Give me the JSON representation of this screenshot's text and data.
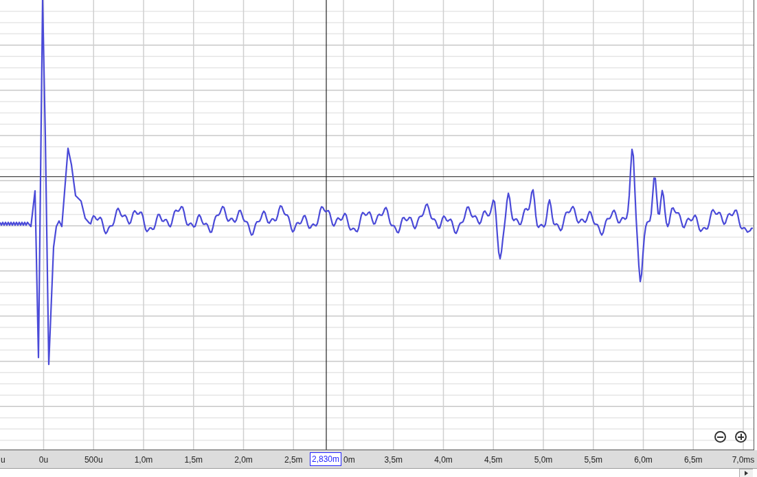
{
  "x_axis": {
    "labels": [
      "u",
      "0u",
      "500u",
      "1,0m",
      "1,5m",
      "2,0m",
      "2,5m",
      "0m",
      "3,5m",
      "4,0m",
      "4,5m",
      "5,0m",
      "5,5m",
      "6,0m",
      "6,5m",
      "7,0ms"
    ]
  },
  "cursor": {
    "readout": "2,830m"
  }
}
